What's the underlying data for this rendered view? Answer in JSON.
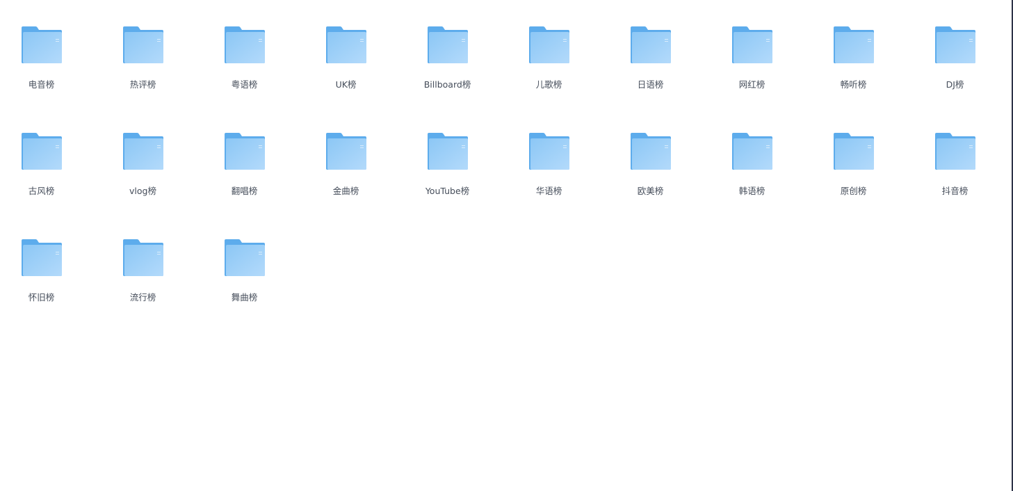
{
  "colors": {
    "folder_back": "#5dacec",
    "folder_front_top": "#8cc7f5",
    "folder_front_bottom": "#b3dafb",
    "label_text": "#454d5a",
    "right_border": "#2d3347"
  },
  "folders": [
    {
      "label": "电音榜",
      "icon": "folder-icon"
    },
    {
      "label": "热评榜",
      "icon": "folder-icon"
    },
    {
      "label": "粤语榜",
      "icon": "folder-icon"
    },
    {
      "label": "UK榜",
      "icon": "folder-icon"
    },
    {
      "label": "Billboard榜",
      "icon": "folder-icon"
    },
    {
      "label": "儿歌榜",
      "icon": "folder-icon"
    },
    {
      "label": "日语榜",
      "icon": "folder-icon"
    },
    {
      "label": "网红榜",
      "icon": "folder-icon"
    },
    {
      "label": "畅听榜",
      "icon": "folder-icon"
    },
    {
      "label": "DJ榜",
      "icon": "folder-icon"
    },
    {
      "label": "古风榜",
      "icon": "folder-icon"
    },
    {
      "label": "vlog榜",
      "icon": "folder-icon"
    },
    {
      "label": "翻唱榜",
      "icon": "folder-icon"
    },
    {
      "label": "金曲榜",
      "icon": "folder-icon"
    },
    {
      "label": "YouTube榜",
      "icon": "folder-icon"
    },
    {
      "label": "华语榜",
      "icon": "folder-icon"
    },
    {
      "label": "欧美榜",
      "icon": "folder-icon"
    },
    {
      "label": "韩语榜",
      "icon": "folder-icon"
    },
    {
      "label": "原创榜",
      "icon": "folder-icon"
    },
    {
      "label": "抖音榜",
      "icon": "folder-icon"
    },
    {
      "label": "怀旧榜",
      "icon": "folder-icon"
    },
    {
      "label": "流行榜",
      "icon": "folder-icon"
    },
    {
      "label": "舞曲榜",
      "icon": "folder-icon"
    }
  ]
}
